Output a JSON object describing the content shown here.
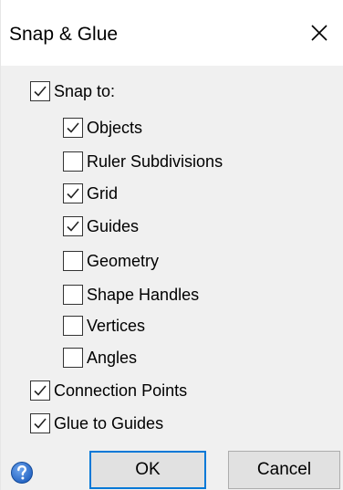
{
  "dialog": {
    "title": "Snap & Glue",
    "close_icon": "close-icon",
    "help_icon": "help-icon"
  },
  "snap_to": {
    "label": "Snap to:",
    "checked": true
  },
  "snap_options": [
    {
      "label": "Objects",
      "checked": true
    },
    {
      "label": "Ruler Subdivisions",
      "checked": false
    },
    {
      "label": "Grid",
      "checked": true
    },
    {
      "label": "Guides",
      "checked": true
    },
    {
      "label": "Geometry",
      "checked": false
    },
    {
      "label": "Shape Handles",
      "checked": false
    },
    {
      "label": "Vertices",
      "checked": false
    },
    {
      "label": "Angles",
      "checked": false
    }
  ],
  "connection_points": {
    "label": "Connection Points",
    "checked": true
  },
  "glue_to_guides": {
    "label": "Glue to Guides",
    "checked": true
  },
  "buttons": {
    "ok": "OK",
    "cancel": "Cancel"
  },
  "colors": {
    "accent": "#0078d7",
    "body_bg": "#f0f0f0",
    "help_blue": "#1f5fbf"
  }
}
